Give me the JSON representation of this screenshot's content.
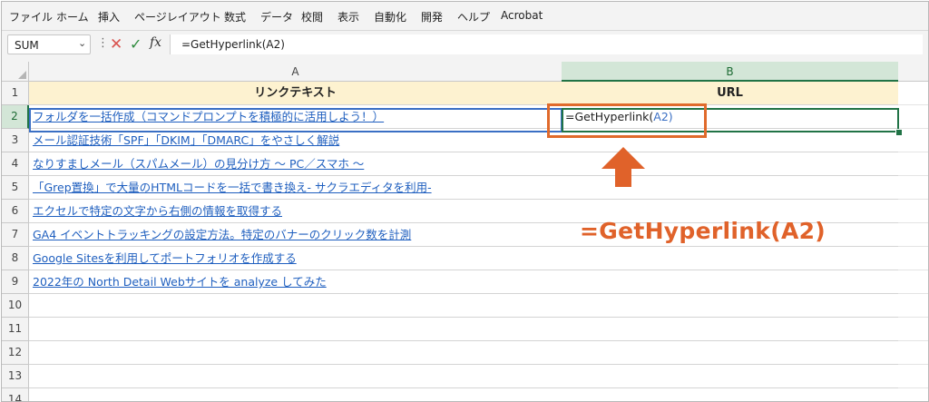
{
  "menu": [
    "ファイル",
    "ホーム",
    "挿入",
    "ページレイアウト",
    "数式",
    "データ",
    "校閲",
    "表示",
    "自動化",
    "開発",
    "ヘルプ",
    "Acrobat"
  ],
  "formula_bar": {
    "name_box": "SUM",
    "cancel_icon": "✕",
    "enter_icon": "✓",
    "fx_label": "fx",
    "formula": "=GetHyperlink(A2)"
  },
  "columns": [
    "A",
    "B"
  ],
  "rows": [
    "1",
    "2",
    "3",
    "4",
    "5",
    "6",
    "7",
    "8",
    "9",
    "10",
    "11",
    "12",
    "13",
    "14"
  ],
  "table": {
    "header_a": "リンクテキスト",
    "header_b": "URL",
    "links": [
      "フォルダを一括作成（コマンドプロンプトを積極的に活用しよう！）",
      "メール認証技術「SPF」「DKIM」「DMARC」をやさしく解説",
      "なりすましメール（スパムメール）の見分け方 ～ PC／スマホ ～",
      "「Grep置換」で大量のHTMLコードを一括で書き換え- サクラエディタを利用-",
      "エクセルで特定の文字から右側の情報を取得する",
      "GA4 イベントトラッキングの設定方法。特定のバナーのクリック数を計測",
      "Google Sitesを利用してポートフォリオを作成する",
      "2022年の North Detail Webサイトを analyze してみた"
    ],
    "b2_fn": "=GetHyperlink(",
    "b2_ref": "A2)"
  },
  "annotation": {
    "label": "=GetHyperlink(A2)",
    "color": "#e0622a"
  },
  "colors": {
    "link": "#1f5fbf",
    "header_fill": "#fdf2d0",
    "excel_green": "#217346",
    "ref_blue": "#3a6fc4"
  }
}
